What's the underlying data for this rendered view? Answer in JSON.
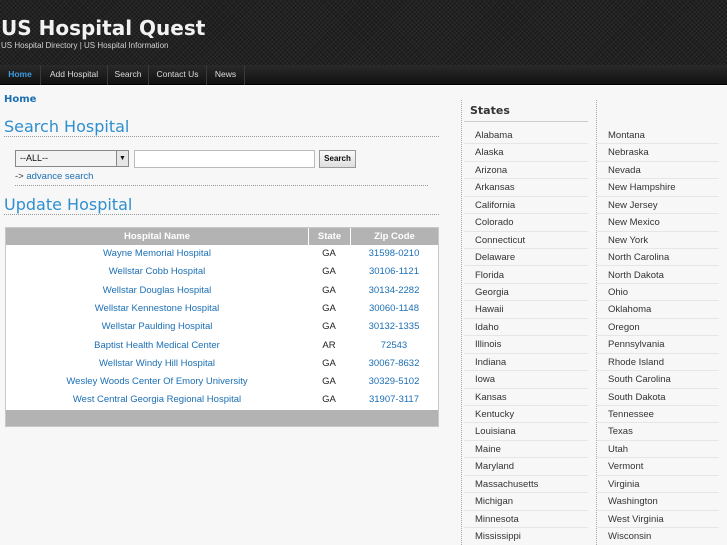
{
  "site": {
    "title": "US Hospital Quest",
    "tagline": "US Hospital Directory | US Hospital Information"
  },
  "nav": [
    {
      "label": "Home",
      "active": true
    },
    {
      "label": "Add Hospital",
      "active": false
    },
    {
      "label": "Search",
      "active": false
    },
    {
      "label": "Contact Us",
      "active": false
    },
    {
      "label": "News",
      "active": false
    }
  ],
  "breadcrumb": "Home",
  "search": {
    "title": "Search Hospital",
    "select_value": "--ALL--",
    "input_value": "",
    "button_label": "Search",
    "adv_prefix": "-> ",
    "adv_link": "advance search"
  },
  "update": {
    "title": "Update Hospital",
    "columns": [
      "Hospital Name",
      "State",
      "Zip Code"
    ],
    "rows": [
      {
        "name": "Wayne Memorial Hospital",
        "state": "GA",
        "zip": "31598-0210"
      },
      {
        "name": "Wellstar Cobb Hospital",
        "state": "GA",
        "zip": "30106-1121"
      },
      {
        "name": "Wellstar Douglas Hospital",
        "state": "GA",
        "zip": "30134-2282"
      },
      {
        "name": "Wellstar Kennestone Hospital",
        "state": "GA",
        "zip": "30060-1148"
      },
      {
        "name": "Wellstar Paulding Hospital",
        "state": "GA",
        "zip": "30132-1335"
      },
      {
        "name": "Baptist Health Medical Center",
        "state": "AR",
        "zip": "72543"
      },
      {
        "name": "Wellstar Windy Hill Hospital",
        "state": "GA",
        "zip": "30067-8632"
      },
      {
        "name": "Wesley Woods Center Of Emory University",
        "state": "GA",
        "zip": "30329-5102"
      },
      {
        "name": "West Central Georgia Regional Hospital",
        "state": "GA",
        "zip": "31907-3117"
      }
    ]
  },
  "states": {
    "title": "States",
    "col1": [
      "Alabama",
      "Alaska",
      "Arizona",
      "Arkansas",
      "California",
      "Colorado",
      "Connecticut",
      "Delaware",
      "Florida",
      "Georgia",
      "Hawaii",
      "Idaho",
      "Illinois",
      "Indiana",
      "Iowa",
      "Kansas",
      "Kentucky",
      "Louisiana",
      "Maine",
      "Maryland",
      "Massachusetts",
      "Michigan",
      "Minnesota",
      "Mississippi"
    ],
    "col2": [
      "Montana",
      "Nebraska",
      "Nevada",
      "New Hampshire",
      "New Jersey",
      "New Mexico",
      "New York",
      "North Carolina",
      "North Dakota",
      "Ohio",
      "Oklahoma",
      "Oregon",
      "Pennsylvania",
      "Rhode Island",
      "South Carolina",
      "South Dakota",
      "Tennessee",
      "Texas",
      "Utah",
      "Vermont",
      "Virginia",
      "Washington",
      "West Virginia",
      "Wisconsin"
    ]
  },
  "colors": {
    "accent": "#2e8fd0",
    "link": "#1c6fb4",
    "header_bg": "#1a1a1a",
    "table_header": "#b3b3b3"
  }
}
